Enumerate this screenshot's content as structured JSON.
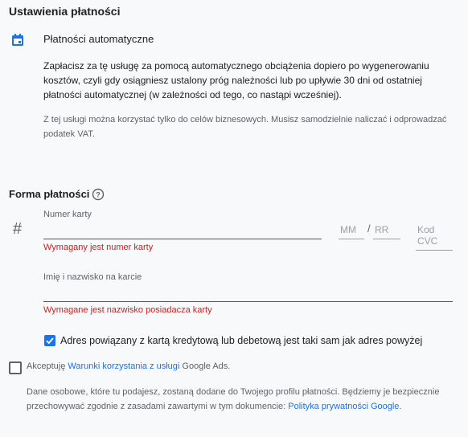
{
  "settings_title": "Ustawienia płatności",
  "auto_payments": {
    "title": "Płatności automatyczne",
    "description": "Zapłacisz za tę usługę za pomocą automatycznego obciążenia dopiero po wygenerowaniu kosztów, czyli gdy osiągniesz ustalony próg należności lub po upływie 30 dni od ostatniej płatności automatycznej (w zależności od tego, co nastąpi wcześniej).",
    "note": "Z tej usługi można korzystać tylko do celów biznesowych. Musisz samodzielnie naliczać i odprowadzać podatek VAT."
  },
  "payment_form": {
    "title": "Forma płatności",
    "card_number_label": "Numer karty",
    "card_number_error": "Wymagany jest numer karty",
    "mm_placeholder": "MM",
    "separator": "/",
    "rr_placeholder": "RR",
    "cvc_placeholder": "Kod CVC",
    "name_label": "Imię i nazwisko na karcie",
    "name_error": "Wymagane jest nazwisko posiadacza karty",
    "address_checkbox_label": "Adres powiązany z kartą kredytową lub debetową jest taki sam jak adres powyżej",
    "address_checked": true
  },
  "terms": {
    "prefix": "Akceptuję ",
    "link": "Warunki korzystania z usługi",
    "suffix": " Google Ads.",
    "checked": false
  },
  "privacy": {
    "text": "Dane osobowe, które tu podajesz, zostaną dodane do Twojego profilu płatności. Będziemy je bezpiecznie przechowywać zgodnie z zasadami zawartymi w tym dokumencie: ",
    "link": "Polityka prywatności Google",
    "suffix": "."
  },
  "icons": {
    "calendar": "calendar-icon",
    "help": "help-circle-icon",
    "hash": "#",
    "check": "check-icon"
  },
  "colors": {
    "accent": "#1a73e8",
    "error": "#c5221f",
    "background": "#f8f9fa"
  }
}
